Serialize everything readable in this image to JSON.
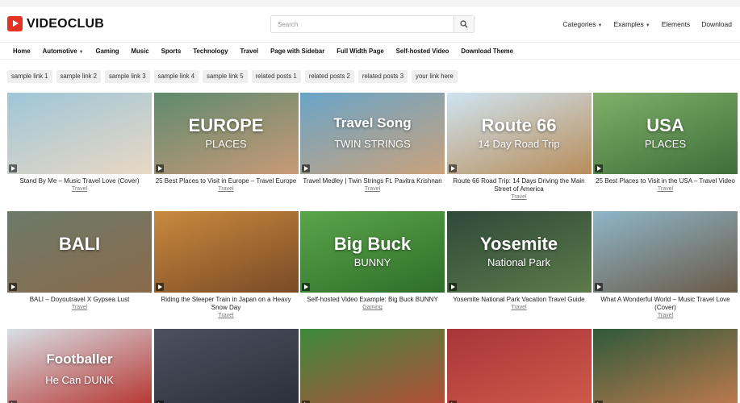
{
  "brand": {
    "name": "VIDEOCLUB"
  },
  "search": {
    "placeholder": "Search"
  },
  "topnav": [
    {
      "label": "Categories",
      "dropdown": true
    },
    {
      "label": "Examples",
      "dropdown": true
    },
    {
      "label": "Elements",
      "dropdown": false
    },
    {
      "label": "Download",
      "dropdown": false
    }
  ],
  "mainnav": [
    {
      "label": "Home",
      "dropdown": false
    },
    {
      "label": "Automotive",
      "dropdown": true
    },
    {
      "label": "Gaming",
      "dropdown": false
    },
    {
      "label": "Music",
      "dropdown": false
    },
    {
      "label": "Sports",
      "dropdown": false
    },
    {
      "label": "Technology",
      "dropdown": false
    },
    {
      "label": "Travel",
      "dropdown": false
    },
    {
      "label": "Page with Sidebar",
      "dropdown": false
    },
    {
      "label": "Full Width Page",
      "dropdown": false
    },
    {
      "label": "Self-hosted Video",
      "dropdown": false
    },
    {
      "label": "Download Theme",
      "dropdown": false
    }
  ],
  "chips": [
    "sample link 1",
    "sample link 2",
    "sample link 3",
    "sample link 4",
    "sample link 5",
    "related posts 1",
    "related posts 2",
    "related posts 3",
    "your link here"
  ],
  "colors": {
    "brand_red": "#e53323",
    "chip_bg": "#efefef",
    "text": "#222222"
  },
  "videos": [
    {
      "title": "Stand By Me – Music Travel Love (Cover)",
      "category": "Travel",
      "thumb_text": "",
      "thumb_sub": "",
      "bg": "#9ec6d8",
      "bg2": "#e9d8c4"
    },
    {
      "title": "25 Best Places to Visit in Europe – Travel Europe",
      "category": "Travel",
      "thumb_text": "EUROPE",
      "thumb_sub": "PLACES",
      "bg": "#5f8a6e",
      "bg2": "#c89a78"
    },
    {
      "title": "Travel Medley | Twin Strings Ft. Pavitra Krishnan",
      "category": "Travel",
      "thumb_text": "Travel Song",
      "thumb_sub": "TWIN STRINGS",
      "bg": "#6aa4c8",
      "bg2": "#c9a27c"
    },
    {
      "title": "Route 66 Road Trip: 14 Days Driving the Main Street of America",
      "category": "Travel",
      "thumb_text": "Route 66",
      "thumb_sub": "14 Day Road Trip",
      "bg": "#cfe4f1",
      "bg2": "#b88d5a"
    },
    {
      "title": "25 Best Places to Visit in the USA – Travel Video",
      "category": "Travel",
      "thumb_text": "USA",
      "thumb_sub": "PLACES",
      "bg": "#7fb06a",
      "bg2": "#3f6e38"
    },
    {
      "title": "BALI – Doyoutravel X Gypsea Lust",
      "category": "Travel",
      "thumb_text": "BALI",
      "thumb_sub": "",
      "bg": "#6c7a6a",
      "bg2": "#8b6a4a"
    },
    {
      "title": "Riding the Sleeper Train in Japan on a Heavy Snow Day",
      "category": "Travel",
      "thumb_text": "",
      "thumb_sub": "",
      "bg": "#c98a3e",
      "bg2": "#7a4a26"
    },
    {
      "title": "Self-hosted Video Example: Big Buck BUNNY",
      "category": "Gaming",
      "thumb_text": "Big Buck",
      "thumb_sub": "BUNNY",
      "bg": "#5aa54a",
      "bg2": "#2f6e2a"
    },
    {
      "title": "Yosemite National Park Vacation Travel Guide",
      "category": "Travel",
      "thumb_text": "Yosemite",
      "thumb_sub": "National Park",
      "bg": "#2e4a3a",
      "bg2": "#5d7a4a"
    },
    {
      "title": "What A Wonderful World – Music Travel Love (Cover)",
      "category": "Travel",
      "thumb_text": "",
      "thumb_sub": "",
      "bg": "#8eb6c8",
      "bg2": "#6a5a48"
    },
    {
      "title": "",
      "category": "",
      "thumb_text": "Footballer",
      "thumb_sub": "He Can DUNK",
      "bg": "#d8dfe6",
      "bg2": "#b5302a"
    },
    {
      "title": "",
      "category": "",
      "thumb_text": "",
      "thumb_sub": "",
      "bg": "#4a5260",
      "bg2": "#2a2e38"
    },
    {
      "title": "",
      "category": "",
      "thumb_text": "",
      "thumb_sub": "",
      "bg": "#3c8a3c",
      "bg2": "#b84a3a"
    },
    {
      "title": "",
      "category": "",
      "thumb_text": "",
      "thumb_sub": "",
      "bg": "#a8363a",
      "bg2": "#d05a4a"
    },
    {
      "title": "",
      "category": "",
      "thumb_text": "",
      "thumb_sub": "",
      "bg": "#2f5a3a",
      "bg2": "#c27a4e"
    }
  ]
}
